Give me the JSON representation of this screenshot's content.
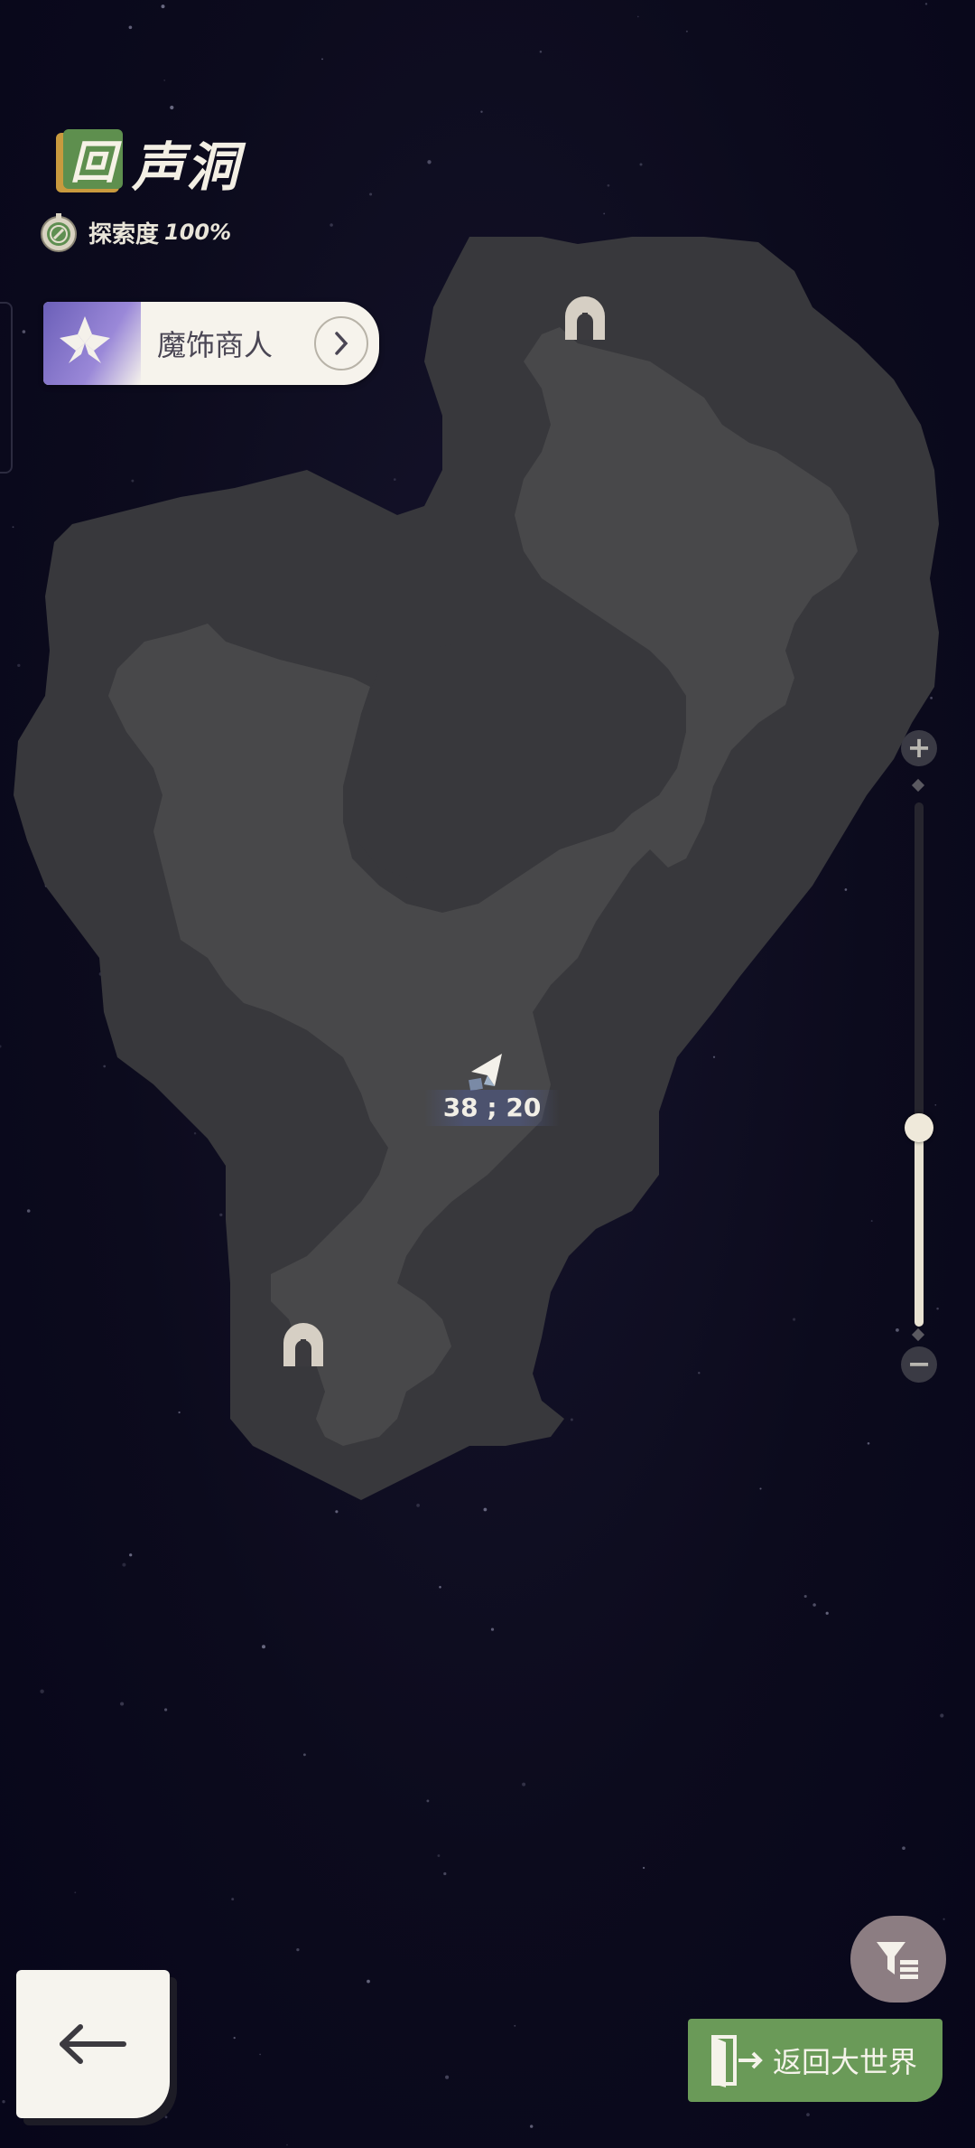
{
  "location": {
    "badge_char": "回",
    "name": "声洞",
    "exploration_label": "探索度",
    "exploration_value": "100%"
  },
  "merchant": {
    "label": "魔饰商人"
  },
  "player": {
    "coordinates": "38 ; 20"
  },
  "zoom": {
    "plus": "+",
    "minus": "−",
    "level": 0.38
  },
  "actions": {
    "return_label": "返回大世界"
  },
  "colors": {
    "background": "#0b0a1c",
    "cave_outer": "#3a3a3d",
    "cave_inner": "#4a4a4c",
    "accent_green": "#6a9a58",
    "merchant_purple": "#7a6cc4"
  },
  "icons": {
    "gate": "cave-gate-icon",
    "player": "player-arrow-icon",
    "compass": "compass-icon",
    "filter": "filter-icon",
    "back": "back-arrow-icon",
    "exit": "exit-door-icon"
  }
}
